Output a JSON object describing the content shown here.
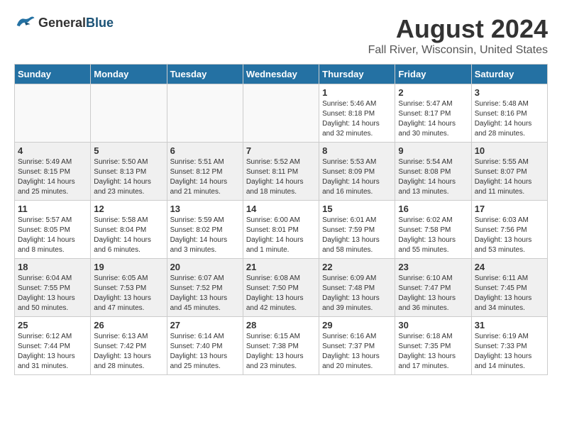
{
  "header": {
    "logo_general": "General",
    "logo_blue": "Blue",
    "title": "August 2024",
    "location": "Fall River, Wisconsin, United States"
  },
  "weekdays": [
    "Sunday",
    "Monday",
    "Tuesday",
    "Wednesday",
    "Thursday",
    "Friday",
    "Saturday"
  ],
  "weeks": [
    [
      {
        "day": "",
        "info": ""
      },
      {
        "day": "",
        "info": ""
      },
      {
        "day": "",
        "info": ""
      },
      {
        "day": "",
        "info": ""
      },
      {
        "day": "1",
        "info": "Sunrise: 5:46 AM\nSunset: 8:18 PM\nDaylight: 14 hours\nand 32 minutes."
      },
      {
        "day": "2",
        "info": "Sunrise: 5:47 AM\nSunset: 8:17 PM\nDaylight: 14 hours\nand 30 minutes."
      },
      {
        "day": "3",
        "info": "Sunrise: 5:48 AM\nSunset: 8:16 PM\nDaylight: 14 hours\nand 28 minutes."
      }
    ],
    [
      {
        "day": "4",
        "info": "Sunrise: 5:49 AM\nSunset: 8:15 PM\nDaylight: 14 hours\nand 25 minutes."
      },
      {
        "day": "5",
        "info": "Sunrise: 5:50 AM\nSunset: 8:13 PM\nDaylight: 14 hours\nand 23 minutes."
      },
      {
        "day": "6",
        "info": "Sunrise: 5:51 AM\nSunset: 8:12 PM\nDaylight: 14 hours\nand 21 minutes."
      },
      {
        "day": "7",
        "info": "Sunrise: 5:52 AM\nSunset: 8:11 PM\nDaylight: 14 hours\nand 18 minutes."
      },
      {
        "day": "8",
        "info": "Sunrise: 5:53 AM\nSunset: 8:09 PM\nDaylight: 14 hours\nand 16 minutes."
      },
      {
        "day": "9",
        "info": "Sunrise: 5:54 AM\nSunset: 8:08 PM\nDaylight: 14 hours\nand 13 minutes."
      },
      {
        "day": "10",
        "info": "Sunrise: 5:55 AM\nSunset: 8:07 PM\nDaylight: 14 hours\nand 11 minutes."
      }
    ],
    [
      {
        "day": "11",
        "info": "Sunrise: 5:57 AM\nSunset: 8:05 PM\nDaylight: 14 hours\nand 8 minutes."
      },
      {
        "day": "12",
        "info": "Sunrise: 5:58 AM\nSunset: 8:04 PM\nDaylight: 14 hours\nand 6 minutes."
      },
      {
        "day": "13",
        "info": "Sunrise: 5:59 AM\nSunset: 8:02 PM\nDaylight: 14 hours\nand 3 minutes."
      },
      {
        "day": "14",
        "info": "Sunrise: 6:00 AM\nSunset: 8:01 PM\nDaylight: 14 hours\nand 1 minute."
      },
      {
        "day": "15",
        "info": "Sunrise: 6:01 AM\nSunset: 7:59 PM\nDaylight: 13 hours\nand 58 minutes."
      },
      {
        "day": "16",
        "info": "Sunrise: 6:02 AM\nSunset: 7:58 PM\nDaylight: 13 hours\nand 55 minutes."
      },
      {
        "day": "17",
        "info": "Sunrise: 6:03 AM\nSunset: 7:56 PM\nDaylight: 13 hours\nand 53 minutes."
      }
    ],
    [
      {
        "day": "18",
        "info": "Sunrise: 6:04 AM\nSunset: 7:55 PM\nDaylight: 13 hours\nand 50 minutes."
      },
      {
        "day": "19",
        "info": "Sunrise: 6:05 AM\nSunset: 7:53 PM\nDaylight: 13 hours\nand 47 minutes."
      },
      {
        "day": "20",
        "info": "Sunrise: 6:07 AM\nSunset: 7:52 PM\nDaylight: 13 hours\nand 45 minutes."
      },
      {
        "day": "21",
        "info": "Sunrise: 6:08 AM\nSunset: 7:50 PM\nDaylight: 13 hours\nand 42 minutes."
      },
      {
        "day": "22",
        "info": "Sunrise: 6:09 AM\nSunset: 7:48 PM\nDaylight: 13 hours\nand 39 minutes."
      },
      {
        "day": "23",
        "info": "Sunrise: 6:10 AM\nSunset: 7:47 PM\nDaylight: 13 hours\nand 36 minutes."
      },
      {
        "day": "24",
        "info": "Sunrise: 6:11 AM\nSunset: 7:45 PM\nDaylight: 13 hours\nand 34 minutes."
      }
    ],
    [
      {
        "day": "25",
        "info": "Sunrise: 6:12 AM\nSunset: 7:44 PM\nDaylight: 13 hours\nand 31 minutes."
      },
      {
        "day": "26",
        "info": "Sunrise: 6:13 AM\nSunset: 7:42 PM\nDaylight: 13 hours\nand 28 minutes."
      },
      {
        "day": "27",
        "info": "Sunrise: 6:14 AM\nSunset: 7:40 PM\nDaylight: 13 hours\nand 25 minutes."
      },
      {
        "day": "28",
        "info": "Sunrise: 6:15 AM\nSunset: 7:38 PM\nDaylight: 13 hours\nand 23 minutes."
      },
      {
        "day": "29",
        "info": "Sunrise: 6:16 AM\nSunset: 7:37 PM\nDaylight: 13 hours\nand 20 minutes."
      },
      {
        "day": "30",
        "info": "Sunrise: 6:18 AM\nSunset: 7:35 PM\nDaylight: 13 hours\nand 17 minutes."
      },
      {
        "day": "31",
        "info": "Sunrise: 6:19 AM\nSunset: 7:33 PM\nDaylight: 13 hours\nand 14 minutes."
      }
    ]
  ]
}
